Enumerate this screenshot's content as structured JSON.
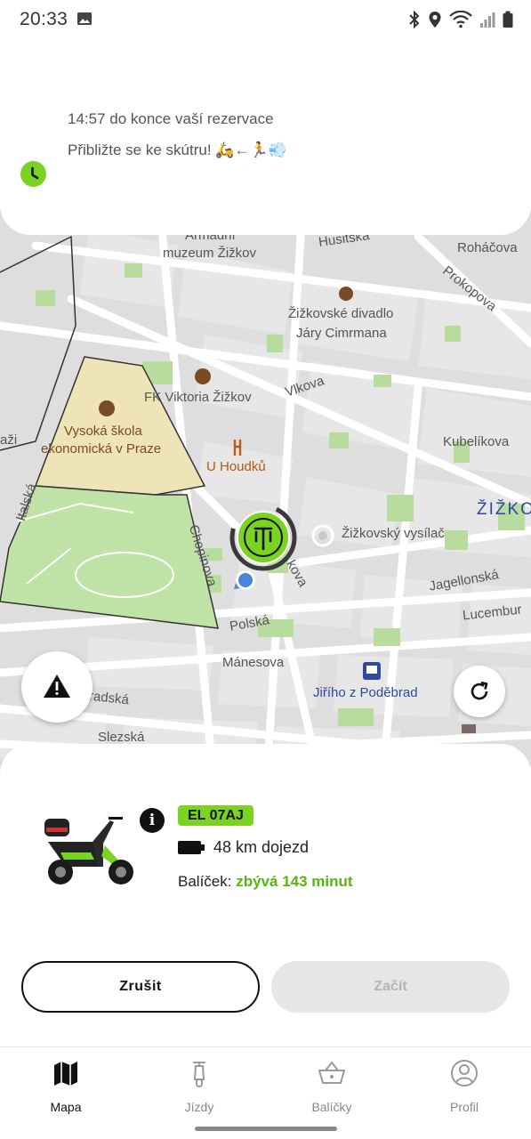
{
  "status_bar": {
    "time": "20:33",
    "icons": [
      "gallery-icon",
      "bluetooth-icon",
      "location-icon",
      "wifi-icon",
      "signal-icon",
      "battery-icon"
    ]
  },
  "reservation": {
    "countdown_text": "14:57 do konce vaší rezervace",
    "hint_text": "Přibližte se ke skútru! 🛵←🏃💨",
    "accent_color": "#7bd321"
  },
  "map": {
    "labels": {
      "museum_1": "Armádní",
      "museum_2": "muzeum Žižkov",
      "husitska": "Husitská",
      "rohacova": "Roháčova",
      "prokopova": "Prokopova",
      "theatre_1": "Žižkovské divadlo",
      "theatre_2": "Járy Cimrmana",
      "viktoria": "FK Viktoria Žižkov",
      "vlkova": "Vlkova",
      "school_1": "Vysoká škola",
      "school_2": "ekonomická v Praze",
      "u_houdku": "U Houdků",
      "kubelikova": "Kubelíkova",
      "italska": "Italská",
      "chopinova": "Chopinova",
      "slavikova": "kova",
      "tower": "Žižkovský vysílač",
      "district": "ŽIŽKO",
      "jagellonska": "Jagellonská",
      "lucemburska": "Lucembur",
      "polska": "Polská",
      "manesova": "Mánesova",
      "jiriho": "Jiřího z Poděbrad",
      "vinohradska": "radská",
      "slezska": "Slezská",
      "edge_left": "aži"
    }
  },
  "vehicle": {
    "plate": "EL 07AJ",
    "range": "48 km dojezd",
    "package_label": "Balíček:",
    "package_remaining": "zbývá 143 minut"
  },
  "actions": {
    "cancel_label": "Zrušit",
    "start_label": "Začít"
  },
  "nav": {
    "items": [
      {
        "label": "Mapa",
        "icon": "map-icon",
        "active": true
      },
      {
        "label": "Jízdy",
        "icon": "scooter-icon",
        "active": false
      },
      {
        "label": "Balíčky",
        "icon": "basket-icon",
        "active": false
      },
      {
        "label": "Profil",
        "icon": "profile-icon",
        "active": false
      }
    ]
  }
}
